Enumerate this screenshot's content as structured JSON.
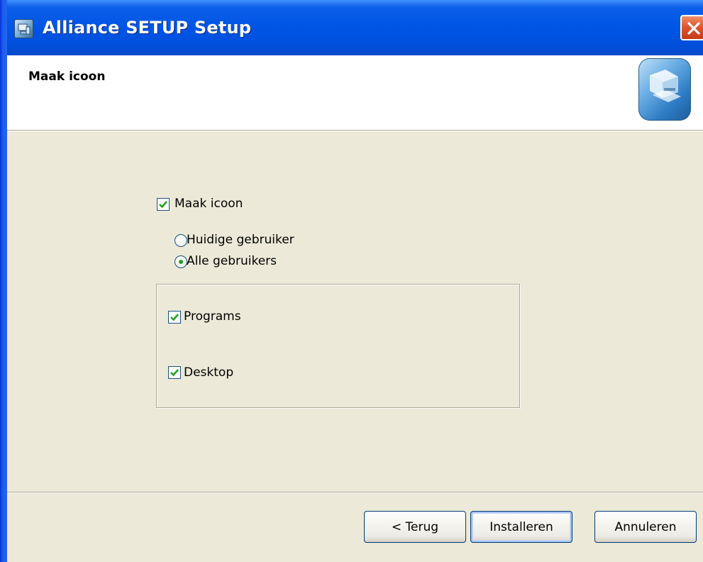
{
  "window": {
    "title": "Alliance SETUP Setup",
    "icons": {
      "app": "installer-app-icon",
      "close": "close-x-icon",
      "header": "computer-setup-icon"
    },
    "colors": {
      "titlebar": "#0055e5",
      "close": "#e0552e",
      "face": "#ece9d8",
      "check": "#21a121"
    }
  },
  "header": {
    "title": "Maak icoon"
  },
  "options": {
    "make_icon": {
      "label": "Maak icoon",
      "checked": true
    },
    "current_user": {
      "label": "Huidige gebruiker",
      "selected": false
    },
    "all_users": {
      "label": "Alle gebruikers",
      "selected": true
    }
  },
  "locations": {
    "programs": {
      "label": "Programs",
      "checked": true
    },
    "desktop": {
      "label": "Desktop",
      "checked": true
    }
  },
  "buttons": {
    "back": "< Terug",
    "install": "Installeren",
    "cancel": "Annuleren"
  }
}
